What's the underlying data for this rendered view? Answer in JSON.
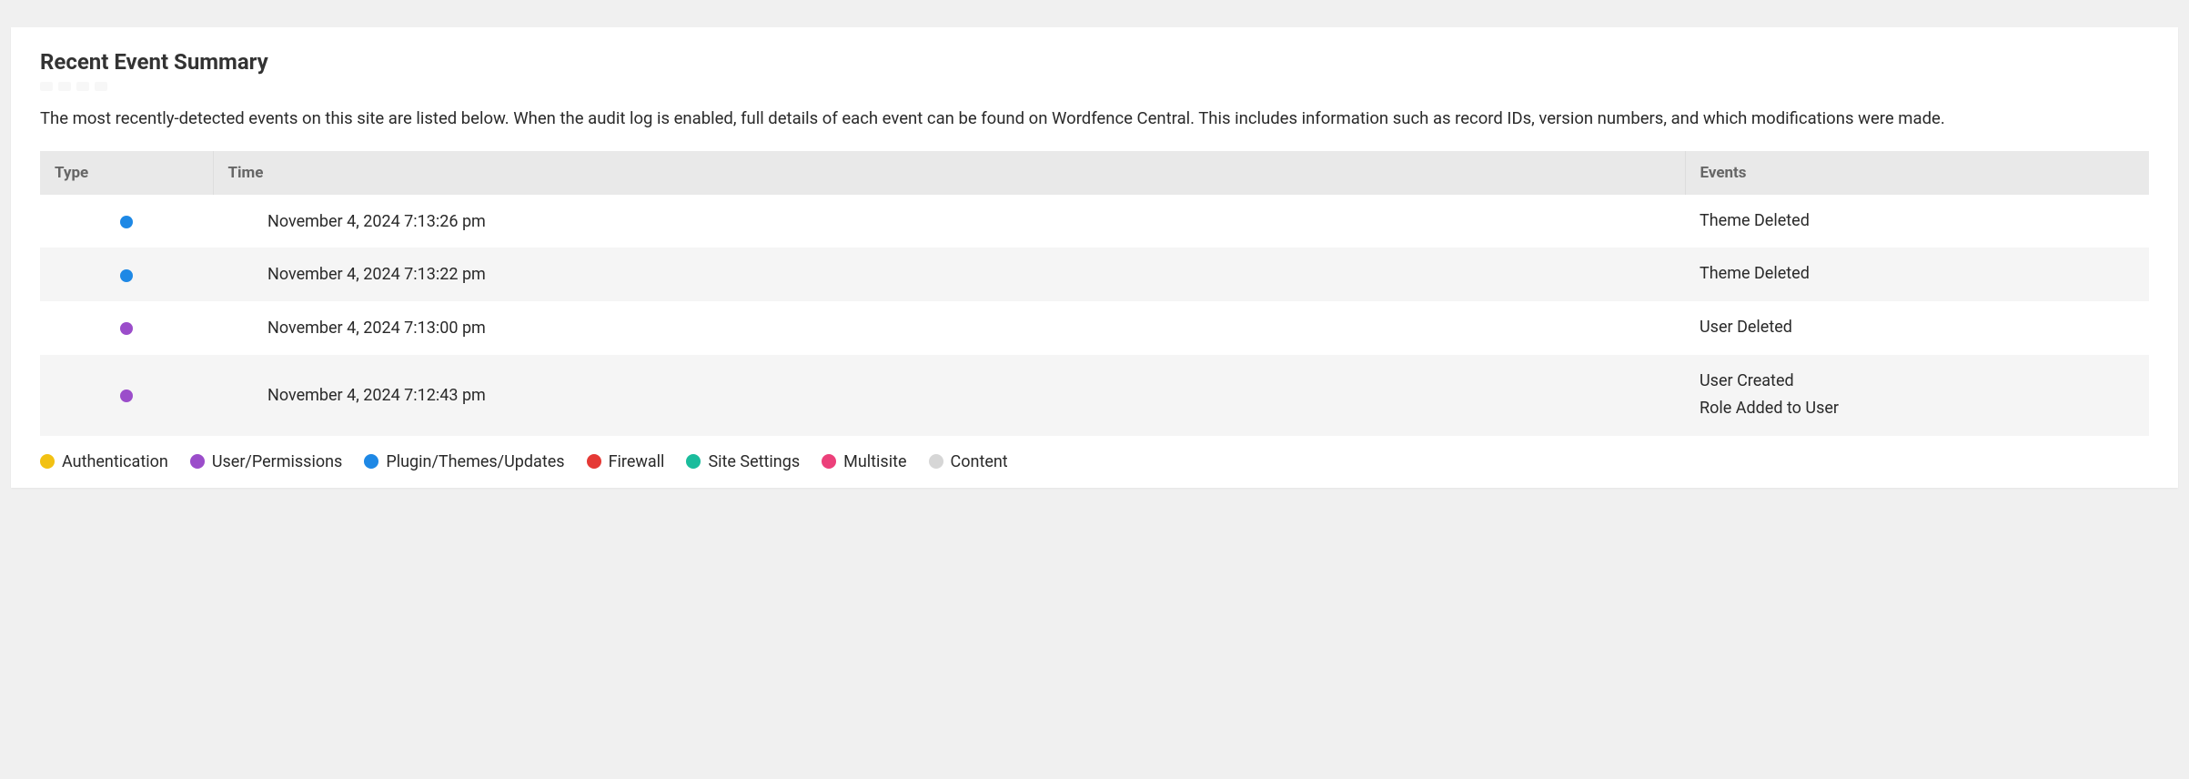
{
  "header": {
    "title": "Recent Event Summary",
    "description": "The most recently-detected events on this site are listed below. When the audit log is enabled, full details of each event can be found on Wordfence Central. This includes information such as record IDs, version numbers, and which modifications were made."
  },
  "table": {
    "columns": {
      "type": "Type",
      "time": "Time",
      "events": "Events"
    },
    "rows": [
      {
        "type_category": "plugin_themes_updates",
        "time": "November 4, 2024 7:13:26 pm",
        "events": [
          "Theme Deleted"
        ]
      },
      {
        "type_category": "plugin_themes_updates",
        "time": "November 4, 2024 7:13:22 pm",
        "events": [
          "Theme Deleted"
        ]
      },
      {
        "type_category": "user_permissions",
        "time": "November 4, 2024 7:13:00 pm",
        "events": [
          "User Deleted"
        ]
      },
      {
        "type_category": "user_permissions",
        "time": "November 4, 2024 7:12:43 pm",
        "events": [
          "User Created",
          "Role Added to User"
        ]
      }
    ]
  },
  "legend": [
    {
      "key": "authentication",
      "label": "Authentication",
      "color": "#f2c113"
    },
    {
      "key": "user_permissions",
      "label": "User/Permissions",
      "color": "#9b4dca"
    },
    {
      "key": "plugin_themes_updates",
      "label": "Plugin/Themes/Updates",
      "color": "#1e88e5"
    },
    {
      "key": "firewall",
      "label": "Firewall",
      "color": "#e53935"
    },
    {
      "key": "site_settings",
      "label": "Site Settings",
      "color": "#1abc9c"
    },
    {
      "key": "multisite",
      "label": "Multisite",
      "color": "#ec407a"
    },
    {
      "key": "content",
      "label": "Content",
      "color": "#d6d6d6"
    }
  ],
  "colors": {
    "authentication": "#f2c113",
    "user_permissions": "#9b4dca",
    "plugin_themes_updates": "#1e88e5",
    "firewall": "#e53935",
    "site_settings": "#1abc9c",
    "multisite": "#ec407a",
    "content": "#d6d6d6"
  }
}
